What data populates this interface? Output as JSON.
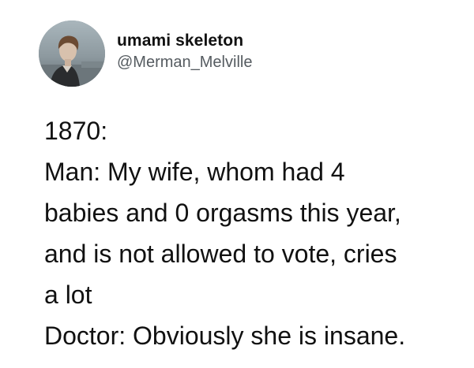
{
  "tweet": {
    "author": {
      "display_name": "umami skeleton",
      "handle": "@Merman_Melville",
      "avatar_icon": "profile-photo-avatar-icon"
    },
    "body_lines": [
      "1870:",
      "Man: My wife, whom had 4",
      "babies and 0 orgasms this year,",
      "and is not allowed to vote, cries",
      "a lot",
      "Doctor: Obviously she is insane."
    ]
  },
  "colors": {
    "background": "#ffffff",
    "text_primary": "#111111",
    "text_secondary": "#555b60"
  }
}
